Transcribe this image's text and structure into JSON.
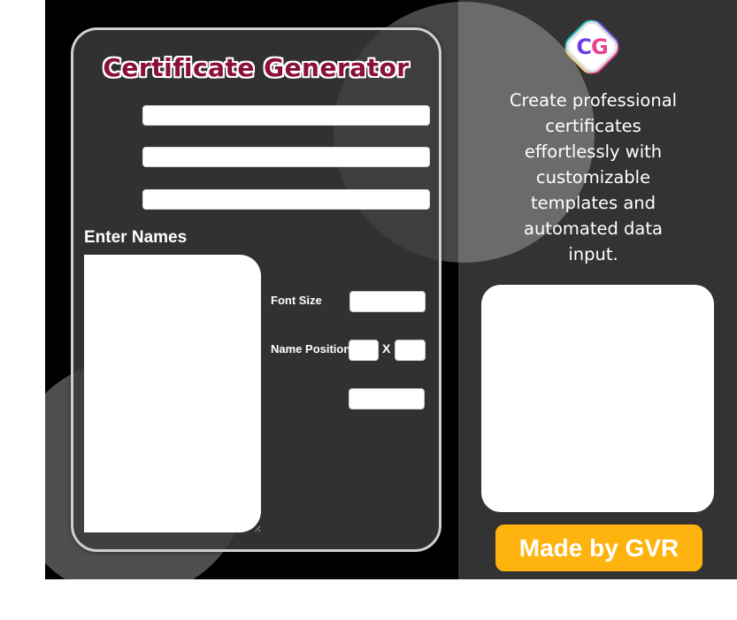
{
  "app": {
    "title": "Certificate Generator"
  },
  "form": {
    "field_1": {
      "value": "",
      "placeholder": ""
    },
    "field_2": {
      "value": "",
      "placeholder": ""
    },
    "field_3": {
      "value": "",
      "placeholder": ""
    },
    "names_label": "Enter Names",
    "names_value": "",
    "font_size_label": "Font Size",
    "font_size_value": "",
    "name_position_label": "Name Position",
    "position_x_value": "",
    "position_separator": "X",
    "position_y_value": "",
    "generate_button_label": ""
  },
  "sidebar": {
    "logo_text_c": "C",
    "logo_text_g": "G",
    "description": "Create professional certificates effortlessly with customizable templates and automated data input.",
    "made_by": "Made by GVR"
  },
  "colors": {
    "title": "#8a0f3c",
    "accent": "#ffb30f",
    "panel": "#333333",
    "background": "#000000"
  },
  "icons": [
    "cg-logo-icon"
  ]
}
